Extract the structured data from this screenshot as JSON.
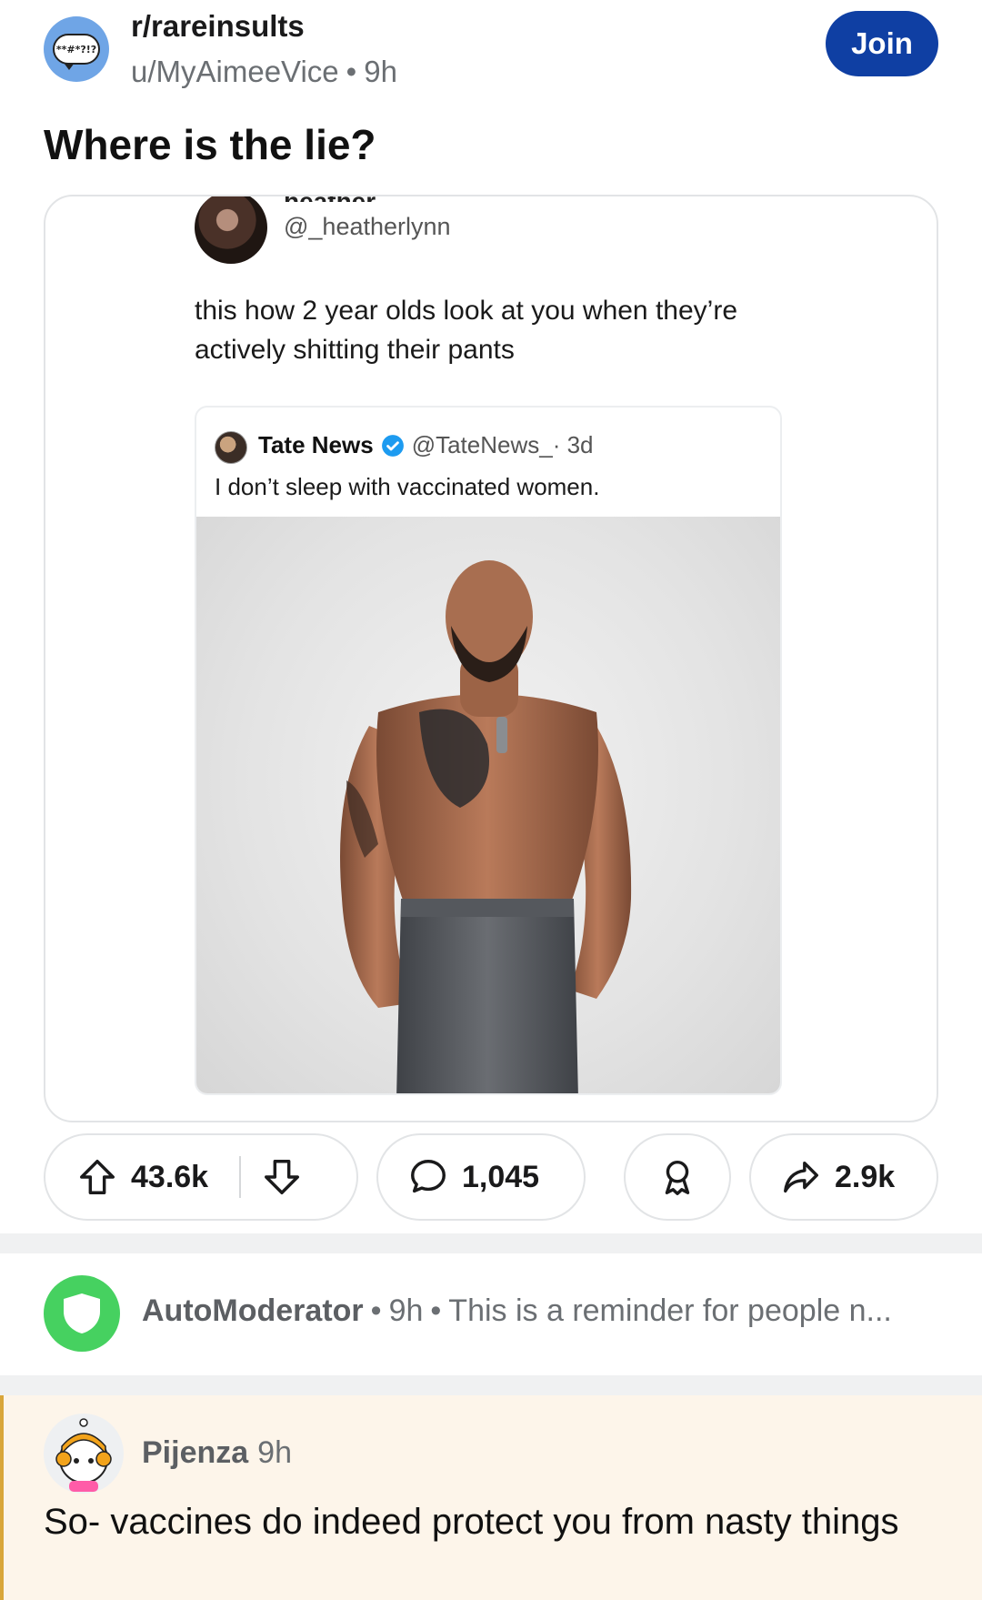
{
  "post": {
    "subreddit": "r/rareinsults",
    "subreddit_icon_text": "**#*?!?",
    "author": "u/MyAimeeVice",
    "separator": "•",
    "age": "9h",
    "join_label": "Join",
    "title": "Where is the lie?"
  },
  "screenshot": {
    "tweet": {
      "name_partial": "heather",
      "handle": "@_heatherlynn",
      "text": "this how 2 year olds look at you when they’re actively shitting their pants"
    },
    "quoted_tweet": {
      "name": "Tate News",
      "handle": "@TateNews_",
      "age": "· 3d",
      "text": "I don’t sleep with vaccinated women."
    }
  },
  "actions": {
    "upvotes": "43.6k",
    "comments": "1,045",
    "shares": "2.9k"
  },
  "comments": {
    "automod": {
      "name": "AutoModerator",
      "separator": "•",
      "age": "9h",
      "preview": "This is a reminder for people n..."
    },
    "top": {
      "name": "Pijenza",
      "age": "9h",
      "body": "So- vaccines do indeed protect you from nasty things"
    }
  },
  "colors": {
    "join_bg": "#0f3fa3",
    "subreddit_icon_bg": "#6fa5e6",
    "automod_green": "#46d160",
    "highlight_bg": "#fdf5ea",
    "highlight_border": "#d9a63a"
  }
}
